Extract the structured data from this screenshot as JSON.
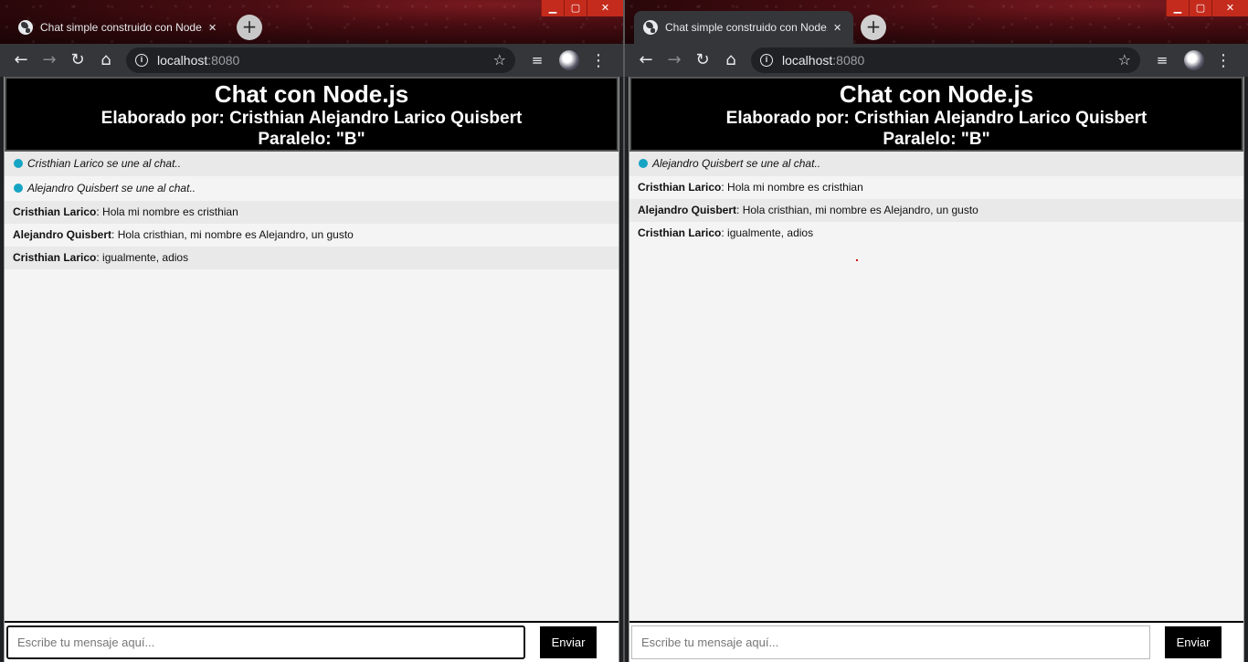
{
  "browser_chrome": {
    "tab_title": "Chat simple construido con Node.js",
    "url_host": "localhost",
    "url_port": ":8080",
    "icons": {
      "back": "←",
      "forward": "→",
      "reload": "↻",
      "home": "⌂",
      "info": "i",
      "star": "☆",
      "queue": "≡",
      "menu": "⋮",
      "close": "✕",
      "new_tab": "+",
      "minimize": "▁",
      "maximize": "▢"
    }
  },
  "chat": {
    "title": "Chat con Node.js",
    "author": "Elaborado por: Cristhian Alejandro Larico Quisbert",
    "section": "Paralelo: \"B\"",
    "input_placeholder": "Escribe tu mensaje aquí...",
    "send_label": "Enviar"
  },
  "left_window": {
    "messages": [
      {
        "type": "system",
        "text": "Cristhian Larico se une al chat.."
      },
      {
        "type": "system",
        "text": "Alejandro Quisbert se une al chat.."
      },
      {
        "type": "user",
        "name": "Cristhian Larico",
        "text": ": Hola mi nombre es cristhian"
      },
      {
        "type": "user",
        "name": "Alejandro Quisbert",
        "text": ": Hola cristhian, mi nombre es Alejandro, un gusto"
      },
      {
        "type": "user",
        "name": "Cristhian Larico",
        "text": ": igualmente, adios"
      }
    ]
  },
  "right_window": {
    "messages": [
      {
        "type": "system",
        "text": "Alejandro Quisbert se une al chat.."
      },
      {
        "type": "user",
        "name": "Cristhian Larico",
        "text": ": Hola mi nombre es cristhian"
      },
      {
        "type": "user",
        "name": "Alejandro Quisbert",
        "text": ": Hola cristhian, mi nombre es Alejandro, un gusto"
      },
      {
        "type": "user",
        "name": "Cristhian Larico",
        "text": ": igualmente, adios"
      }
    ]
  },
  "colors": {
    "system_dot": "#16a4c4",
    "header_bg": "#000000",
    "window_close": "#c42b1c"
  }
}
